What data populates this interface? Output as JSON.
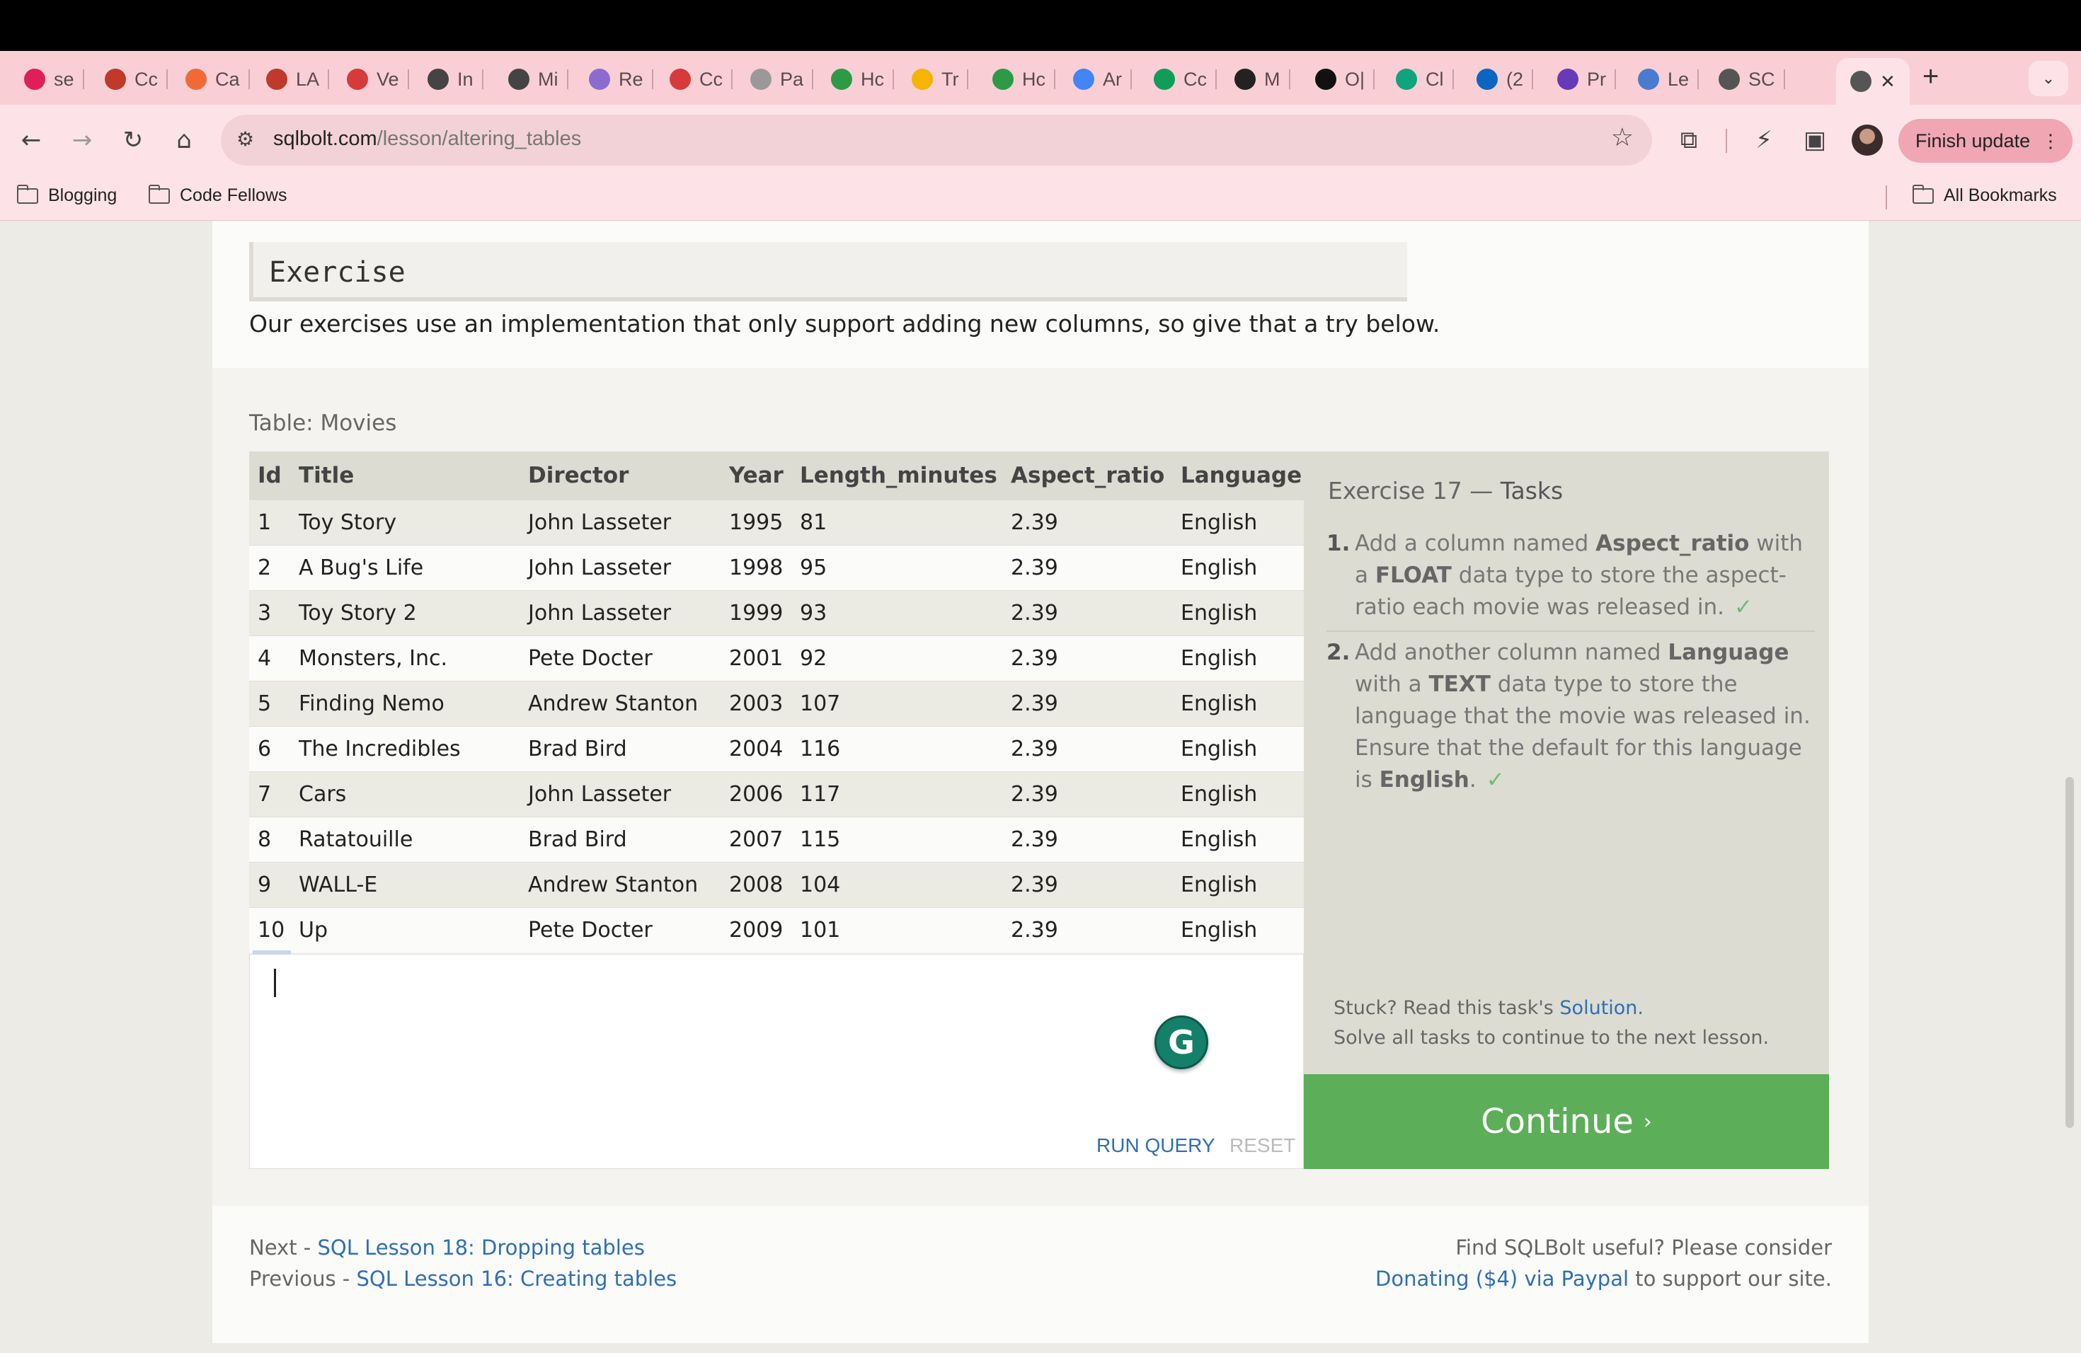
{
  "browser": {
    "tabs": [
      {
        "label": "se",
        "icon": "slack-icon",
        "color": "#e01e5a"
      },
      {
        "label": "Cc",
        "icon": "codefellows-icon",
        "color": "#c0392b"
      },
      {
        "label": "Ca",
        "icon": "asana-icon",
        "color": "#f06a35"
      },
      {
        "label": "LA",
        "icon": "codefellows-icon",
        "color": "#c0392b"
      },
      {
        "label": "Ve",
        "icon": "shield-icon",
        "color": "#d63b3b"
      },
      {
        "label": "In",
        "icon": "circle-logo-icon",
        "color": "#444444"
      },
      {
        "label": "Mi",
        "icon": "circle-logo-icon",
        "color": "#444444"
      },
      {
        "label": "Re",
        "icon": "cube-icon",
        "color": "#8c6bd1"
      },
      {
        "label": "Cc",
        "icon": "shield-icon",
        "color": "#d63b3b"
      },
      {
        "label": "Pa",
        "icon": "globe-icon",
        "color": "#999999"
      },
      {
        "label": "Hc",
        "icon": "google-drive-icon",
        "color": "#2d9b46"
      },
      {
        "label": "Tr",
        "icon": "slides-icon",
        "color": "#f4b400"
      },
      {
        "label": "Hc",
        "icon": "google-drive-icon",
        "color": "#2d9b46"
      },
      {
        "label": "Ar",
        "icon": "docs-icon",
        "color": "#4285f4"
      },
      {
        "label": "Cc",
        "icon": "sheets-icon",
        "color": "#0f9d58"
      },
      {
        "label": "M",
        "icon": "github-icon",
        "color": "#222222"
      },
      {
        "label": "O|",
        "icon": "openai-icon",
        "color": "#111111"
      },
      {
        "label": "Cl",
        "icon": "chatgpt-icon",
        "color": "#10a37f"
      },
      {
        "label": "(2",
        "icon": "linkedin-icon",
        "color": "#0a66c2"
      },
      {
        "label": "Pr",
        "icon": "forms-icon",
        "color": "#673ab7"
      },
      {
        "label": "Le",
        "icon": "app-icon",
        "color": "#4a7bd0"
      },
      {
        "label": "SC",
        "icon": "database-icon",
        "color": "#555555"
      }
    ],
    "new_tab": "+",
    "url_domain": "sqlbolt.com",
    "url_path": "/lesson/altering_tables",
    "finish_update": "Finish update",
    "bookmarks": [
      {
        "label": "Blogging"
      },
      {
        "label": "Code Fellows"
      }
    ],
    "all_bookmarks": "All Bookmarks"
  },
  "exercise": {
    "heading": "Exercise",
    "description": "Our exercises use an implementation that only support adding new columns, so give that a try below.",
    "table_label": "Table: Movies",
    "columns": [
      "Id",
      "Title",
      "Director",
      "Year",
      "Length_minutes",
      "Aspect_ratio",
      "Language"
    ],
    "rows": [
      [
        "1",
        "Toy Story",
        "John Lasseter",
        "1995",
        "81",
        "2.39",
        "English"
      ],
      [
        "2",
        "A Bug's Life",
        "John Lasseter",
        "1998",
        "95",
        "2.39",
        "English"
      ],
      [
        "3",
        "Toy Story 2",
        "John Lasseter",
        "1999",
        "93",
        "2.39",
        "English"
      ],
      [
        "4",
        "Monsters, Inc.",
        "Pete Docter",
        "2001",
        "92",
        "2.39",
        "English"
      ],
      [
        "5",
        "Finding Nemo",
        "Andrew Stanton",
        "2003",
        "107",
        "2.39",
        "English"
      ],
      [
        "6",
        "The Incredibles",
        "Brad Bird",
        "2004",
        "116",
        "2.39",
        "English"
      ],
      [
        "7",
        "Cars",
        "John Lasseter",
        "2006",
        "117",
        "2.39",
        "English"
      ],
      [
        "8",
        "Ratatouille",
        "Brad Bird",
        "2007",
        "115",
        "2.39",
        "English"
      ],
      [
        "9",
        "WALL-E",
        "Andrew Stanton",
        "2008",
        "104",
        "2.39",
        "English"
      ],
      [
        "10",
        "Up",
        "Pete Docter",
        "2009",
        "101",
        "2.39",
        "English"
      ]
    ],
    "run_query": "RUN QUERY",
    "reset": "RESET",
    "grammarly": "G"
  },
  "tasks": {
    "title_prefix": "Exercise 17 — ",
    "title_suffix": "Tasks",
    "items": [
      {
        "num": "1.",
        "t1": "Add a column named ",
        "b1": "Aspect_ratio",
        "t2": " with a ",
        "b2": "FLOAT",
        "t3": " data type to store the aspect-ratio each movie was released in.",
        "check": "✓"
      },
      {
        "num": "2.",
        "t1": "Add another column named ",
        "b1": "Language",
        "t2": " with a ",
        "b2": "TEXT",
        "t3": " data type to store the language that the movie was released in. Ensure that the default for this language is ",
        "b3": "English",
        "t4": ".",
        "check": "✓"
      }
    ],
    "stuck_prefix": "Stuck? Read this task's ",
    "solution": "Solution",
    "stuck_suffix": ".",
    "solve_all": "Solve all tasks to continue to the next lesson.",
    "continue": "Continue",
    "continue_arrow": "›"
  },
  "footer": {
    "next_prefix": "Next - ",
    "next_link": "SQL Lesson 18: Dropping tables",
    "prev_prefix": "Previous - ",
    "prev_link": "SQL Lesson 16: Creating tables",
    "useful": "Find SQLBolt useful? Please consider",
    "donate_link": "Donating ($4) via Paypal",
    "donate_suffix": " to support our site."
  },
  "colors": {
    "accent_green": "#5cae58",
    "link_blue": "#2e6fb5",
    "browser_pink": "#fde3e7"
  }
}
